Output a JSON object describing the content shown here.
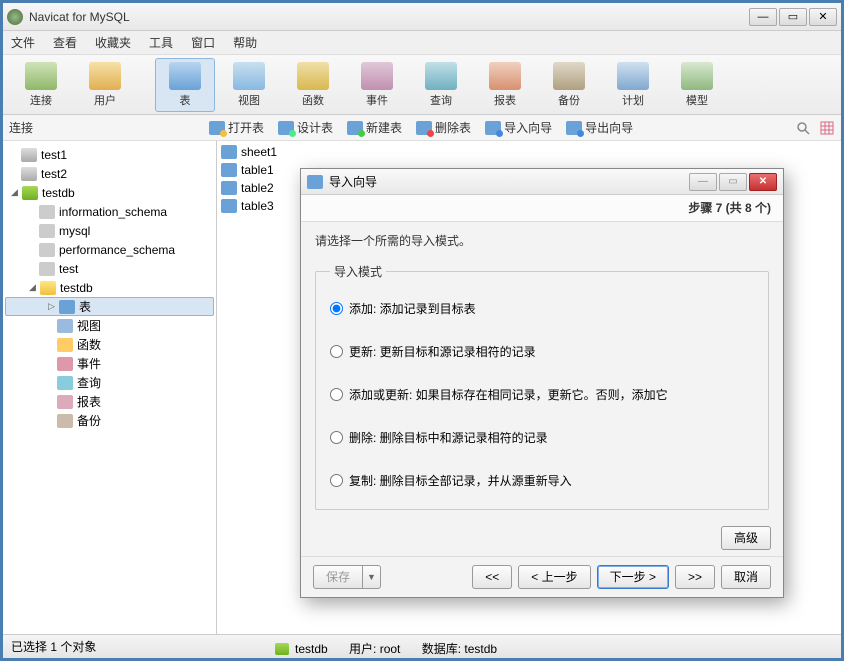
{
  "titlebar": {
    "title": "Navicat for MySQL"
  },
  "menu": {
    "file": "文件",
    "view": "查看",
    "fav": "收藏夹",
    "tools": "工具",
    "window": "窗口",
    "help": "帮助"
  },
  "toolbar": {
    "connect": "连接",
    "user": "用户",
    "table": "表",
    "view": "视图",
    "func": "函数",
    "event": "事件",
    "query": "查询",
    "report": "报表",
    "backup": "备份",
    "schedule": "计划",
    "model": "模型"
  },
  "subbar": {
    "label": "连接",
    "openTable": "打开表",
    "designTable": "设计表",
    "newTable": "新建表",
    "deleteTable": "删除表",
    "importWizard": "导入向导",
    "exportWizard": "导出向导"
  },
  "tree": {
    "test1": "test1",
    "test2": "test2",
    "testdb": "testdb",
    "information_schema": "information_schema",
    "mysql": "mysql",
    "performance_schema": "performance_schema",
    "test": "test",
    "testdb_inner": "testdb",
    "tables_label": "表",
    "views_label": "视图",
    "funcs_label": "函数",
    "events_label": "事件",
    "queries_label": "查询",
    "reports_label": "报表",
    "backups_label": "备份"
  },
  "list": {
    "sheet1": "sheet1",
    "table1": "table1",
    "table2": "table2",
    "table3": "table3"
  },
  "status": {
    "left": "已选择 1 个对象",
    "db": "testdb",
    "user_label": "用户: root",
    "db_label": "数据库: testdb"
  },
  "dialog": {
    "title": "导入向导",
    "step": "步骤 7 (共 8 个)",
    "prompt": "请选择一个所需的导入模式。",
    "legend": "导入模式",
    "opt_add": "添加: 添加记录到目标表",
    "opt_update": "更新: 更新目标和源记录相符的记录",
    "opt_addupdate": "添加或更新: 如果目标存在相同记录，更新它。否则，添加它",
    "opt_delete": "删除: 删除目标中和源记录相符的记录",
    "opt_copy": "复制: 删除目标全部记录，并从源重新导入",
    "advanced": "高级",
    "save": "保存",
    "first": "<<",
    "prev": "< 上一步",
    "next": "下一步 >",
    "last": ">>",
    "cancel": "取消"
  }
}
